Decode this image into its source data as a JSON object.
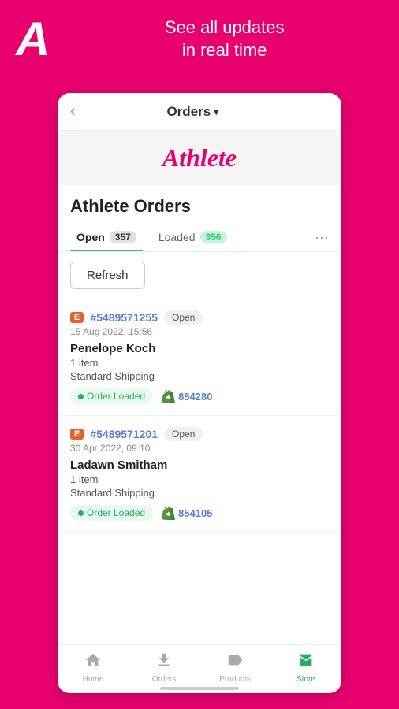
{
  "topHeader": {
    "logoLetter": "A",
    "tagline": "See all updates\nin real time"
  },
  "nav": {
    "backIcon": "‹",
    "title": "Orders",
    "dropdownArrow": "▾"
  },
  "brand": {
    "name": "Athlete"
  },
  "pageTitle": "Athlete Orders",
  "tabs": [
    {
      "label": "Open",
      "badge": "357",
      "badgeType": "default",
      "active": true
    },
    {
      "label": "Loaded",
      "badge": "356",
      "badgeType": "green",
      "active": false
    }
  ],
  "moreButtonLabel": "···",
  "refreshButton": "Refresh",
  "orders": [
    {
      "sourceBadge": "E",
      "orderNumber": "#5489571255",
      "status": "Open",
      "date": "15 Aug 2022, 15:56",
      "customer": "Penelope Koch",
      "items": "1 item",
      "shipping": "Standard Shipping",
      "loadedLabel": "Order Loaded",
      "shopifyNumber": "854280"
    },
    {
      "sourceBadge": "E",
      "orderNumber": "#5489571201",
      "status": "Open",
      "date": "30 Apr 2022, 09:10",
      "customer": "Ladawn Smitham",
      "items": "1 item",
      "shipping": "Standard Shipping",
      "loadedLabel": "Order Loaded",
      "shopifyNumber": "854105"
    }
  ],
  "bottomNav": [
    {
      "icon": "🏠",
      "label": "Home",
      "active": false
    },
    {
      "icon": "⬇️",
      "label": "Orders",
      "active": false
    },
    {
      "icon": "🏷️",
      "label": "Products",
      "active": false
    },
    {
      "icon": "🏪",
      "label": "Store",
      "active": true
    }
  ]
}
